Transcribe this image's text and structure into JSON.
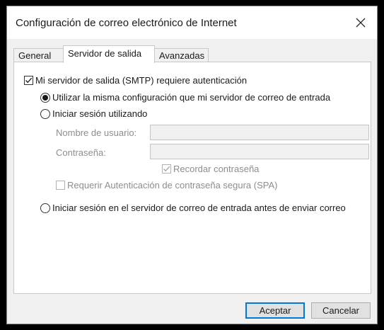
{
  "dialog": {
    "title": "Configuración de correo electrónico de Internet",
    "close_icon": "close-icon"
  },
  "tabs": [
    {
      "label": "General",
      "active": false
    },
    {
      "label": "Servidor de salida",
      "active": true
    },
    {
      "label": "Avanzadas",
      "active": false
    }
  ],
  "outgoing": {
    "smtp_auth_label": "Mi servidor de salida (SMTP) requiere autenticación",
    "smtp_auth_checked": true,
    "same_settings_label": "Utilizar la misma configuración que mi servidor de correo de entrada",
    "same_settings_selected": true,
    "login_using_label": "Iniciar sesión utilizando",
    "login_using_selected": false,
    "username_label": "Nombre de usuario:",
    "username_value": "",
    "password_label": "Contraseña:",
    "password_value": "",
    "remember_password_label": "Recordar contraseña",
    "remember_password_checked": true,
    "spa_label": "Requerir Autenticación de contraseña segura (SPA)",
    "spa_checked": false,
    "login_before_send_label": "Iniciar sesión en el servidor de correo de entrada antes de enviar correo",
    "login_before_send_selected": false
  },
  "buttons": {
    "accept_label": "Aceptar",
    "cancel_label": "Cancelar"
  },
  "colors": {
    "accent": "#0078d7",
    "disabled_text": "#8d8d8d"
  }
}
